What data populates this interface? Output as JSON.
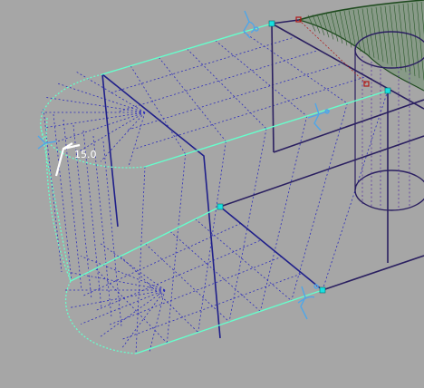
{
  "viewport": {
    "background": "#a6a6a6",
    "colors": {
      "wire": "#1f1f8a",
      "wire_dark": "#2a1f60",
      "mesh": "#2c2cbc",
      "selection": "#66ffcc",
      "constraint": "#4fa6e8",
      "surface": "#2b5a2b",
      "marker": "#b01818"
    }
  },
  "dimension": {
    "value": "15.0",
    "icon": "angle-dimension-icon"
  },
  "constraints": {
    "icon": "tangency-constraint-icon",
    "items": [
      "top-edge",
      "middle-edge",
      "bottom-edge",
      "nose-left"
    ]
  },
  "markers": {
    "icon": "endpoint-marker-icon"
  }
}
